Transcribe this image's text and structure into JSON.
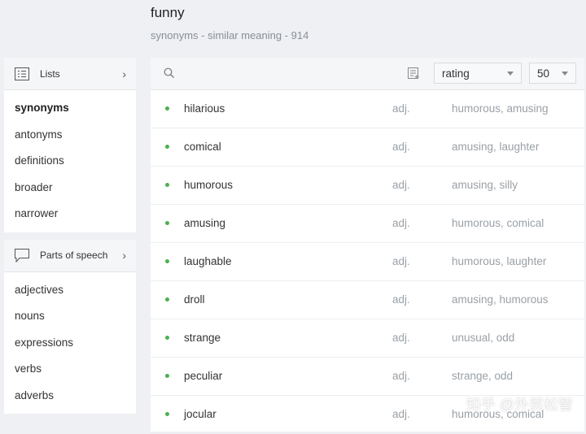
{
  "header": {
    "word": "funny",
    "subtitle": "synonyms - similar meaning - 914"
  },
  "sidebar": {
    "lists_panel": {
      "title": "Lists",
      "items": [
        "synonyms",
        "antonyms",
        "definitions",
        "broader",
        "narrower"
      ],
      "active": "synonyms"
    },
    "pos_panel": {
      "title": "Parts of speech",
      "items": [
        "adjectives",
        "nouns",
        "expressions",
        "verbs",
        "adverbs"
      ]
    }
  },
  "toolbar": {
    "sort_value": "rating",
    "count_value": "50"
  },
  "results": [
    {
      "word": "hilarious",
      "pos": "adj.",
      "related": "humorous,  amusing"
    },
    {
      "word": "comical",
      "pos": "adj.",
      "related": "amusing,  laughter"
    },
    {
      "word": "humorous",
      "pos": "adj.",
      "related": "amusing,  silly"
    },
    {
      "word": "amusing",
      "pos": "adj.",
      "related": "humorous,  comical"
    },
    {
      "word": "laughable",
      "pos": "adj.",
      "related": "humorous,  laughter"
    },
    {
      "word": "droll",
      "pos": "adj.",
      "related": "amusing,  humorous"
    },
    {
      "word": "strange",
      "pos": "adj.",
      "related": "unusual,  odd"
    },
    {
      "word": "peculiar",
      "pos": "adj.",
      "related": "strange,  odd"
    },
    {
      "word": "jocular",
      "pos": "adj.",
      "related": "humorous,  comical"
    }
  ],
  "watermark": "知乎 @外贸松智",
  "colors": {
    "bullet": "#4caf50",
    "background": "#eef0f3"
  }
}
